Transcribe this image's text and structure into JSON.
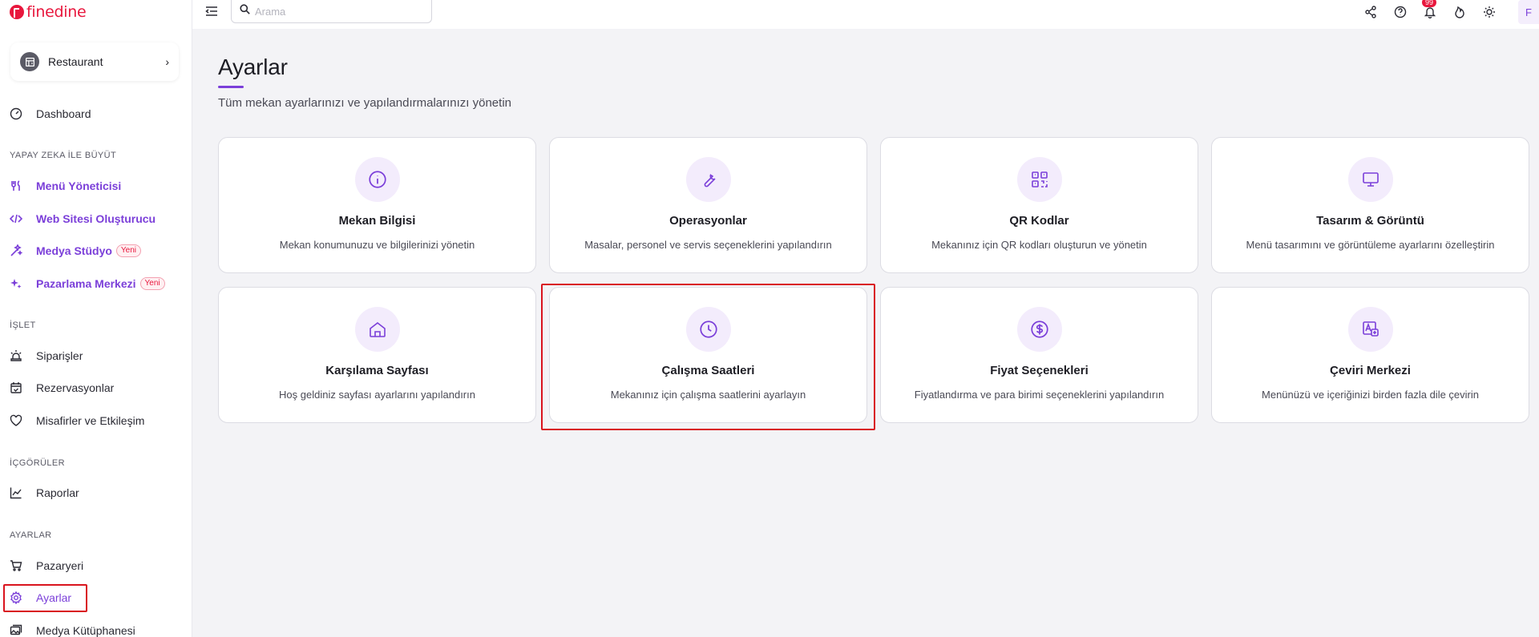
{
  "brand": {
    "name": "finedine",
    "color": "#e8173d"
  },
  "accent": "#7b3fd9",
  "venue": {
    "name": "Restaurant"
  },
  "sidebar": {
    "dashboard": "Dashboard",
    "section_ai": "YAPAY ZEKA İLE BÜYÜT",
    "menu_manager": "Menü Yöneticisi",
    "website_builder": "Web Sitesi Oluşturucu",
    "media_studio": "Medya Stüdyo",
    "marketing_center": "Pazarlama Merkezi",
    "new_badge": "Yeni",
    "section_operate": "İŞLET",
    "orders": "Siparişler",
    "reservations": "Rezervasyonlar",
    "guests": "Misafirler ve Etkileşim",
    "section_insights": "İÇGÖRÜLER",
    "reports": "Raporlar",
    "section_settings": "AYARLAR",
    "marketplace": "Pazaryeri",
    "settings": "Ayarlar",
    "media_library": "Medya Kütüphanesi"
  },
  "header": {
    "search_placeholder": "Arama",
    "notification_count": "99",
    "avatar_initial": "F"
  },
  "page": {
    "title": "Ayarlar",
    "subtitle": "Tüm mekan ayarlarınızı ve yapılandırmalarınızı yönetin"
  },
  "cards": [
    {
      "icon": "info-icon",
      "title": "Mekan Bilgisi",
      "desc": "Mekan konumunuzu ve bilgilerinizi yönetin"
    },
    {
      "icon": "wrench-icon",
      "title": "Operasyonlar",
      "desc": "Masalar, personel ve servis seçeneklerini yapılandırın"
    },
    {
      "icon": "qr-code-icon",
      "title": "QR Kodlar",
      "desc": "Mekanınız için QR kodları oluşturun ve yönetin"
    },
    {
      "icon": "monitor-icon",
      "title": "Tasarım & Görüntü",
      "desc": "Menü tasarımını ve görüntüleme ayarlarını özelleştirin"
    },
    {
      "icon": "home-icon",
      "title": "Karşılama Sayfası",
      "desc": "Hoş geldiniz sayfası ayarlarını yapılandırın"
    },
    {
      "icon": "clock-icon",
      "title": "Çalışma Saatleri",
      "desc": "Mekanınız için çalışma saatlerini ayarlayın"
    },
    {
      "icon": "dollar-icon",
      "title": "Fiyat Seçenekleri",
      "desc": "Fiyatlandırma ve para birimi seçeneklerini yapılandırın"
    },
    {
      "icon": "translate-icon",
      "title": "Çeviri Merkezi",
      "desc": "Menünüzü ve içeriğinizi birden fazla dile çevirin"
    }
  ]
}
